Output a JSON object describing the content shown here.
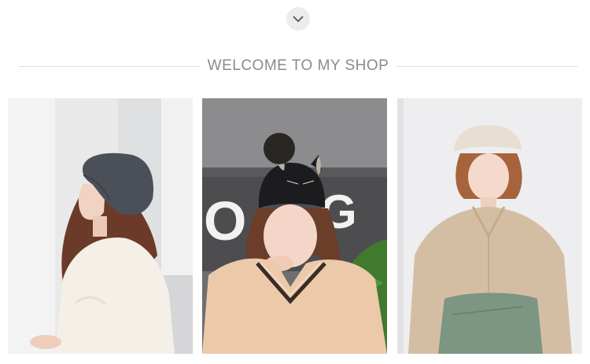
{
  "scroll_control": {
    "icon": "chevron-down-icon"
  },
  "shop_header": {
    "title": "WELCOME TO MY SHOP"
  },
  "products": [
    {
      "subject": "woman-grey-beanie-white-fleece"
    },
    {
      "subject": "woman-black-cat-ear-pompom-beanie"
    },
    {
      "subject": "woman-beige-beanie-beige-shirt"
    }
  ],
  "colors": {
    "header_text": "#8a8a8a",
    "divider": "#dedede",
    "scroll_button_bg": "#ececec"
  }
}
